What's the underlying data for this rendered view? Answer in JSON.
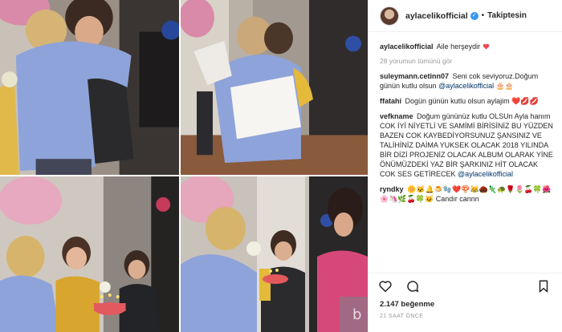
{
  "post": {
    "username": "aylacelikofficial",
    "follow_status": "Takiptesin",
    "separator": "•",
    "caption_text": "Aile herşeydir ",
    "caption_emoji": "heart",
    "view_all_comments": "28 yorumun tümünü gör",
    "comments": [
      {
        "user": "suleymann.cetinn07",
        "text": "Seni cok seviyoruz.Doğum günün kutlu olsun",
        "mention": "@aylacelikofficial",
        "emojis": "🎂🎂"
      },
      {
        "user": "ffatahi",
        "text": "Dogün günün kutlu olsun aylajim",
        "emojis": "❤️💋💋"
      },
      {
        "user": "vefkname",
        "text": "Doğum gününüz kutlu OLSUn Ayla hanım COK İYİ NİYETLİ VE SAMİMİ BİRİSİNİZ BU YÜZDEN BAZEN COK KAYBEDİYORSUNUZ ŞANSINIZ VE TALİHİNİZ DAİMA YUKSEK OLACAK 2018 YILINDA BİR DİZİ PROJENİZ OLACAK ALBUM OLARAK YİNE ÖNÜMÜZDEKİ YAZ BİR ŞARKINIZ HİT OLACAK COK SES GETİRECEK",
        "mention": "@aylacelikofficial"
      },
      {
        "user": "ryndky",
        "emojis": "🌼🐱🔔🍮🧤❤️🍄😹🌰🦎🐢🌹🌷🍒🍀🌺🌸🦄🌿🍒🍀🐱",
        "text": " Candır cannn"
      }
    ],
    "likes": "2.147 beğenme",
    "time_ago": "21 SAAT ÖNCE"
  },
  "colors": {
    "link": "#003569",
    "muted": "#999999",
    "verified": "#3897f0",
    "heart": "#ed4956"
  },
  "icons": [
    "verified-badge-icon",
    "heart-icon",
    "comment-icon",
    "bookmark-icon"
  ]
}
